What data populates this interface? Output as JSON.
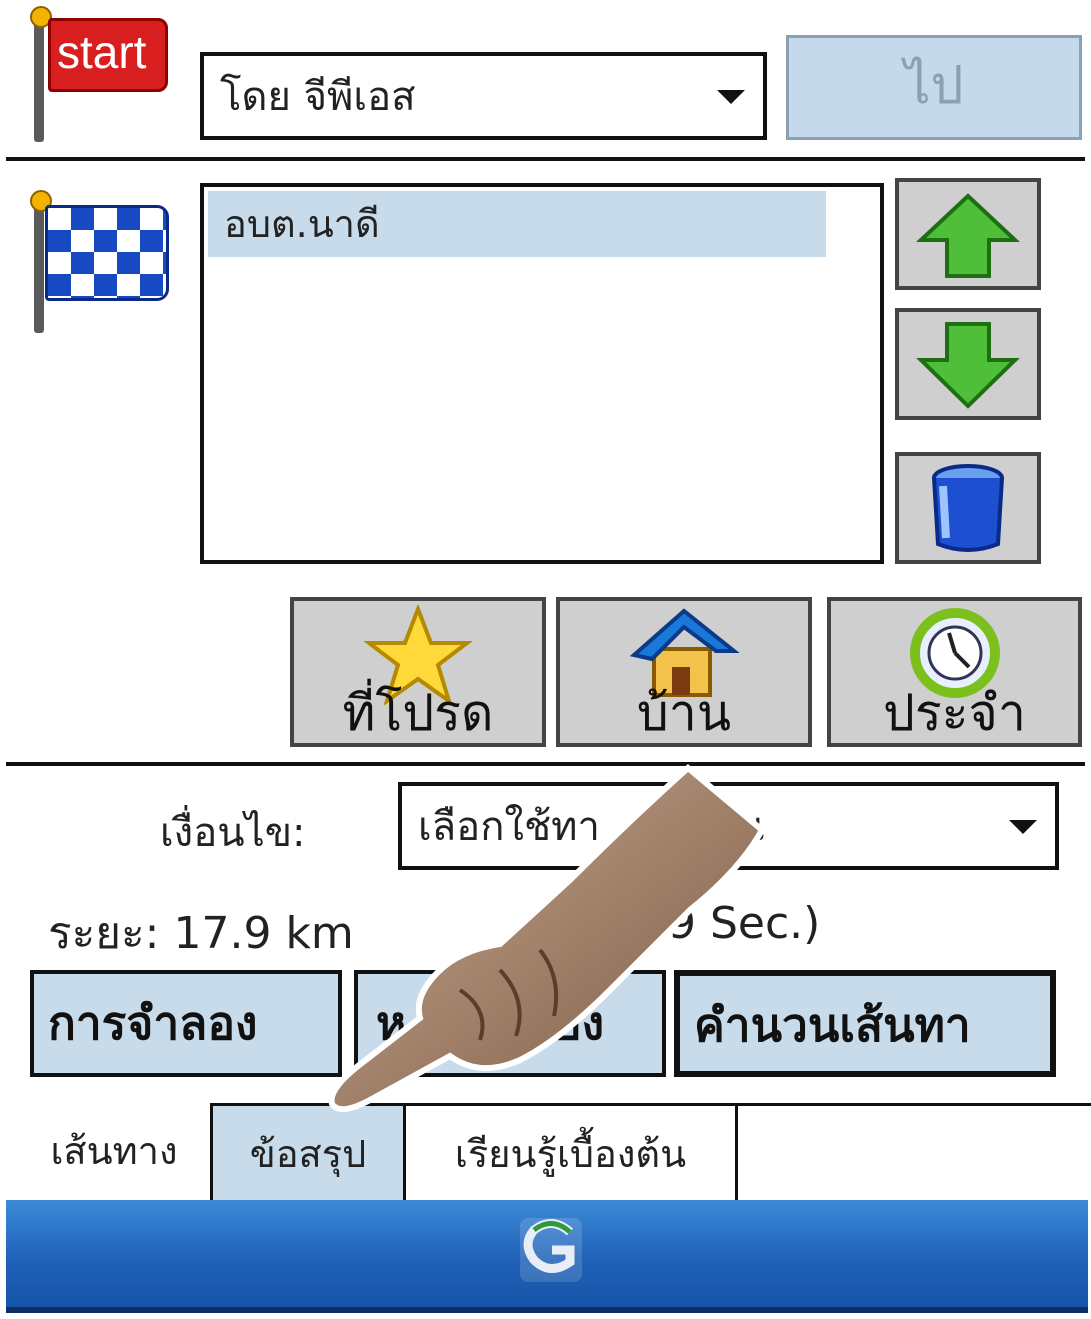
{
  "start": {
    "flag_label": "start",
    "source_value": "โดย จีพีเอส",
    "go_label": "ไป"
  },
  "destination": {
    "items": [
      "อบต.นาดี"
    ]
  },
  "side_buttons": {
    "up_icon": "green-up-arrow-icon",
    "down_icon": "green-down-arrow-icon",
    "delete_icon": "blue-trash-bin-icon"
  },
  "quick_buttons": [
    {
      "label": "ที่โปรด",
      "icon": "star-icon"
    },
    {
      "label": "บ้าน",
      "icon": "house-icon"
    },
    {
      "label": "ประจำ",
      "icon": "clock-icon"
    }
  ],
  "condition": {
    "label": "เงื่อนไข:",
    "value": "เลือกใช้ทา",
    "value_tail": "น"
  },
  "summary": {
    "distance": "ระยะ: 17.9 km",
    "time_partial": "09 Sec.)"
  },
  "actions": {
    "simulate": "การจำลอง",
    "middle_left": "ห",
    "middle_right": "อง",
    "calculate": "คำนวนเส้นทา"
  },
  "tabs": [
    "เส้นทาง",
    "ข้อสรุป",
    "เรียนรู้เบื้องต้น"
  ],
  "colors": {
    "selection": "#c8dbea",
    "taskbar": "#1f62b8",
    "start_flag": "#d81e1e"
  }
}
